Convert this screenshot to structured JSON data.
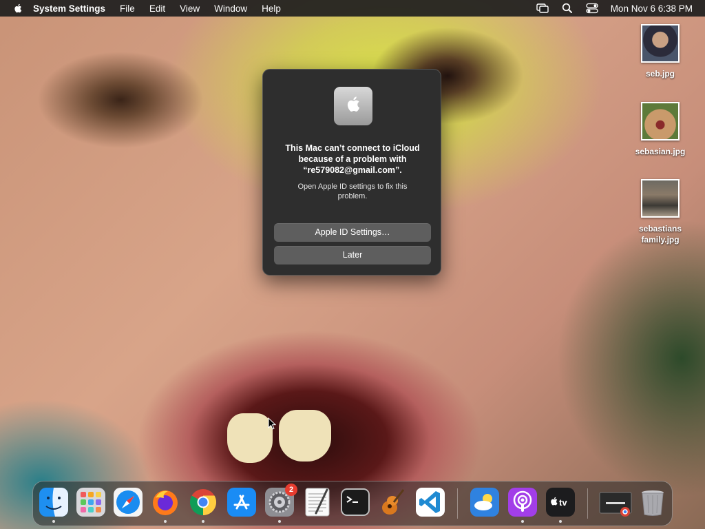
{
  "menubar": {
    "app_name": "System Settings",
    "menus": [
      "File",
      "Edit",
      "View",
      "Window",
      "Help"
    ],
    "clock": "Mon Nov 6  6:38 PM",
    "status_icons": [
      "screen-mirroring-icon",
      "spotlight-search-icon",
      "control-center-icon"
    ]
  },
  "desktop": {
    "files": [
      {
        "name": "seb.jpg"
      },
      {
        "name": "sebasian.jpg"
      },
      {
        "name": "sebastians family.jpg"
      }
    ]
  },
  "dialog": {
    "icon": "system-settings-icon",
    "title": "This Mac can’t connect to iCloud because of a problem with “re579082@gmail.com”.",
    "message": "Open Apple ID settings to fix this problem.",
    "primary_button": "Apple ID Settings…",
    "secondary_button": "Later"
  },
  "dock": {
    "apps": [
      {
        "name": "Finder",
        "running": true
      },
      {
        "name": "Launchpad",
        "running": false
      },
      {
        "name": "Safari",
        "running": false
      },
      {
        "name": "Firefox",
        "running": true
      },
      {
        "name": "Google Chrome",
        "running": true
      },
      {
        "name": "App Store",
        "running": false
      },
      {
        "name": "System Settings",
        "running": true,
        "badge": "2"
      },
      {
        "name": "TextEdit",
        "running": false
      },
      {
        "name": "Terminal",
        "running": false
      },
      {
        "name": "GarageBand",
        "running": false
      },
      {
        "name": "Visual Studio Code",
        "running": false
      },
      {
        "name": "Weather",
        "running": false
      },
      {
        "name": "Podcasts",
        "running": true
      },
      {
        "name": "TV",
        "running": true
      },
      {
        "name": "Chrome Window",
        "running": false
      },
      {
        "name": "Trash",
        "running": false
      }
    ],
    "tv_label": "tv"
  },
  "colors": {
    "menubar_bg": "#1e1e1e",
    "dialog_bg": "#2e2e2e",
    "button_bg": "#5e5e5e",
    "badge_red": "#e83c2f"
  }
}
